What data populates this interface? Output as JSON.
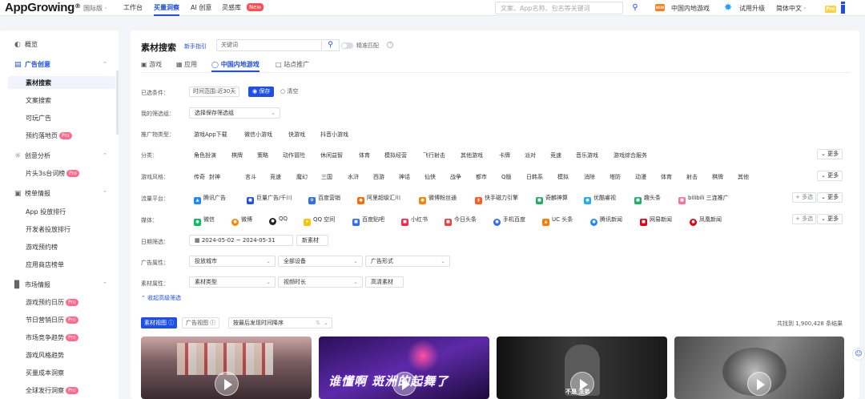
{
  "app": {
    "logo": "AppGrowing",
    "logo_sup": "®",
    "edition": "国际版 ·"
  },
  "top_nav": [
    {
      "label": "工作台"
    },
    {
      "label": "买量洞察"
    },
    {
      "label": "AI 创意"
    },
    {
      "label": "灵感库"
    }
  ],
  "top_nav_badge": "New",
  "top_search": {
    "placeholder": "文案、App名称、包名等关键词"
  },
  "top_links": {
    "region": "中国内地游戏",
    "upgrade": "试用升级",
    "lang": "简体中文 ·",
    "hot": "NEW",
    "pro": "Pro"
  },
  "sidebar": {
    "overview": "概览",
    "groups": [
      {
        "label": "广告创意",
        "items": [
          "素材搜索",
          "文案搜索",
          "可玩广告",
          "预约落地页"
        ]
      },
      {
        "label": "创意分析",
        "items": [
          "片头3s台词榜"
        ]
      },
      {
        "label": "榜单情报",
        "items": [
          "App 投放排行",
          "开发者投放排行",
          "游戏预约榜",
          "应用商店榜单"
        ]
      },
      {
        "label": "市场情报",
        "items": [
          "游戏预约日历",
          "节日营销日历",
          "市场竞争趋势",
          "游戏风格趋势",
          "买量成本洞察",
          "全球发行洞察"
        ]
      }
    ],
    "pro": "Pro"
  },
  "main": {
    "title": "素材搜索",
    "guide": "新手指引",
    "keyword": "关键词",
    "fuzzy": "精准匹配",
    "tabs": [
      "游戏",
      "应用",
      "中国内地游戏",
      "站点推广"
    ],
    "filters": {
      "selected_label": "已选条件：",
      "selected_chip": "时间范围:近30天",
      "save": "保存",
      "clear": "清空",
      "my_group_label": "我的筛选组：",
      "my_group_placeholder": "选择保存筛选组",
      "promo_label": "推广物类型：",
      "promo": [
        "游戏App下载",
        "微信小游戏",
        "快游戏",
        "抖音小游戏"
      ],
      "category_label": "分类：",
      "category": [
        "角色扮演",
        "棋牌",
        "策略",
        "动作冒险",
        "休闲益智",
        "体育",
        "模拟经营",
        "飞行射击",
        "其他游戏",
        "卡牌",
        "派对",
        "竞速",
        "音乐游戏",
        "游戏综合服务"
      ],
      "style_label": "游戏风格：",
      "style": [
        "传奇",
        "封神",
        "言斗",
        "竞速",
        "魔幻",
        "三国",
        "水浒",
        "西游",
        "神话",
        "仙侠",
        "战争",
        "都市",
        "Q版",
        "日韩系",
        "模拟",
        "消除",
        "塔防",
        "动漫",
        "体育",
        "射击",
        "棋牌",
        "其他"
      ],
      "platform_label": "流量平台：",
      "platform": [
        "腾讯广告",
        "巨量广告/千川",
        "百度营销",
        "阿里超级汇川",
        "微博粉丝通",
        "快手磁力引擎",
        "奇麟神算",
        "优酷睿视",
        "趣头条",
        "bilibili 三连推广"
      ],
      "media_label": "媒体：",
      "media": [
        "微信",
        "微博",
        "QQ",
        "QQ 空间",
        "百度贴吧",
        "小红书",
        "今日头条",
        "手机百度",
        "UC 头条",
        "腾讯新闻",
        "网易新闻",
        "凤凰新闻"
      ],
      "date_label": "日期筛选：",
      "date_range": "2024-05-02 ~ 2024-05-31",
      "new_material": "新素材",
      "ad_attr_label": "广告属性：",
      "ad_attr": [
        "投放城市",
        "全部设备",
        "广告形式"
      ],
      "material_attr_label": "素材属性：",
      "material_attr": [
        "素材类型",
        "视频时长",
        "高清素材"
      ],
      "more": "更多",
      "multi": "多选",
      "collapse": "收起高级筛选"
    },
    "view_material": "素材视图",
    "view_ad": "广告视图",
    "sort": "按最后发现时间降序",
    "result": "共找到 1,900,428 条结果",
    "card_text": "谁懂啊 斑洲的起舞了",
    "card_badge": "不是 法弟"
  }
}
